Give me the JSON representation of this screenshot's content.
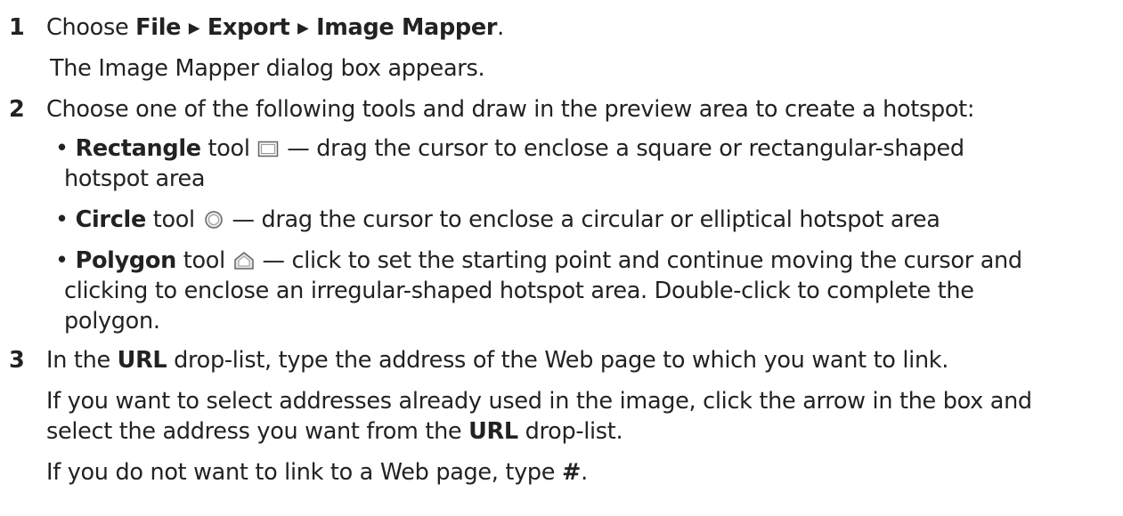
{
  "steps": [
    {
      "number": "1",
      "main": {
        "t1": "Choose ",
        "menu1": "File",
        "sep1": " ▸ ",
        "menu2": "Export",
        "sep2": " ▸ ",
        "menu3": "Image Mapper",
        "t2": "."
      },
      "result": "The Image Mapper dialog box appears."
    },
    {
      "number": "2",
      "main": "Choose one of the following tools and draw in the preview area to create a hotspot:",
      "bullets": [
        {
          "bullet": "•",
          "label": "Rectangle",
          "tool": " tool ",
          "icon": "rectangle-tool-icon",
          "dash": " — ",
          "text1": "drag the cursor to enclose a square or rectangular-shaped",
          "text2": "hotspot area"
        },
        {
          "bullet": "•",
          "label": "Circle",
          "tool": " tool ",
          "icon": "circle-tool-icon",
          "dash": " — ",
          "text1": "drag the cursor to enclose a circular or elliptical hotspot area"
        },
        {
          "bullet": "•",
          "label": "Polygon",
          "tool": " tool ",
          "icon": "polygon-tool-icon",
          "dash": " — ",
          "text1": "click to set the starting point and continue moving the cursor and",
          "text2": "clicking to enclose an irregular-shaped hotspot area. Double-click to complete the",
          "text3": "polygon."
        }
      ]
    },
    {
      "number": "3",
      "main": {
        "t1": "In the ",
        "bold": "URL",
        "t2": " drop-list, type the address of the Web page to which you want to link."
      },
      "para1": {
        "line1": "If you want to select addresses already used in the image, click the arrow in the box and",
        "line2a": "select the address you want from the ",
        "bold": "URL",
        "line2b": " drop-list."
      },
      "para2": {
        "t1": "If you do not want to link to a Web page, type ",
        "bold": "#",
        "t2": "."
      }
    }
  ]
}
